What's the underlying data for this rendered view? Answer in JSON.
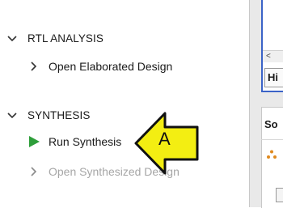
{
  "flow_navigator": {
    "sections": [
      {
        "label": "RTL ANALYSIS",
        "items": [
          {
            "label": "Open Elaborated Design"
          }
        ]
      },
      {
        "label": "SYNTHESIS",
        "items": [
          {
            "label": "Run Synthesis",
            "icon": "play-icon"
          },
          {
            "label": "Open Synthesized Design",
            "state": "disabled"
          }
        ]
      }
    ]
  },
  "right_panel": {
    "scroll_left_glyph": "<",
    "tab_label": "Hi",
    "header_label": "So"
  },
  "callout": {
    "label": "A"
  },
  "colors": {
    "play_green": "#2e9e3a",
    "callout_yellow": "#f3ee12",
    "panel_border_blue": "#3b63c7",
    "disabled_text": "#a6a6a6"
  }
}
